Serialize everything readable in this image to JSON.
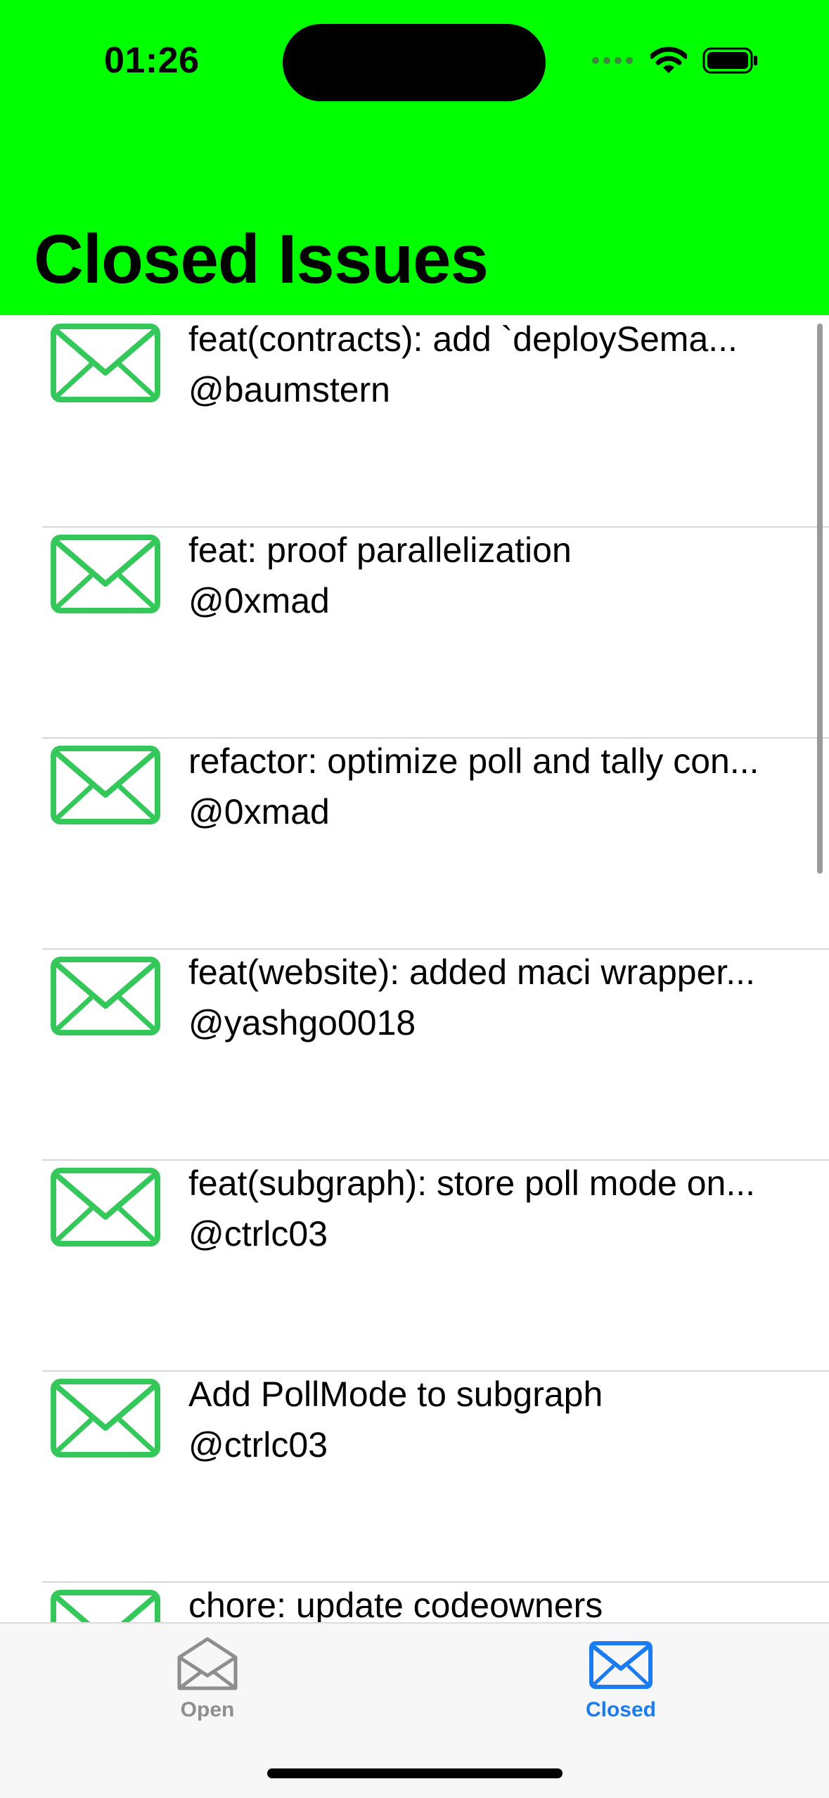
{
  "status_bar": {
    "time": "01:26"
  },
  "header": {
    "title": "Closed Issues"
  },
  "issues": [
    {
      "title": "feat(contracts): add `deploySema...",
      "author": "@baumstern"
    },
    {
      "title": "feat: proof parallelization",
      "author": "@0xmad"
    },
    {
      "title": "refactor: optimize poll and tally con...",
      "author": "@0xmad"
    },
    {
      "title": "feat(website): added maci wrapper...",
      "author": "@yashgo0018"
    },
    {
      "title": "feat(subgraph): store poll mode on...",
      "author": "@ctrlc03"
    },
    {
      "title": "Add PollMode to subgraph",
      "author": "@ctrlc03"
    },
    {
      "title": "chore: update codeowners",
      "author": ""
    }
  ],
  "tabs": [
    {
      "label": "Open",
      "icon": "envelope-open-icon",
      "selected": false
    },
    {
      "label": "Closed",
      "icon": "envelope-icon",
      "selected": true
    }
  ],
  "colors": {
    "header_bg": "#00ff00",
    "issue_icon": "#34c759",
    "tab_selected": "#1a7cf0",
    "tab_unselected": "#8e8e8e"
  }
}
